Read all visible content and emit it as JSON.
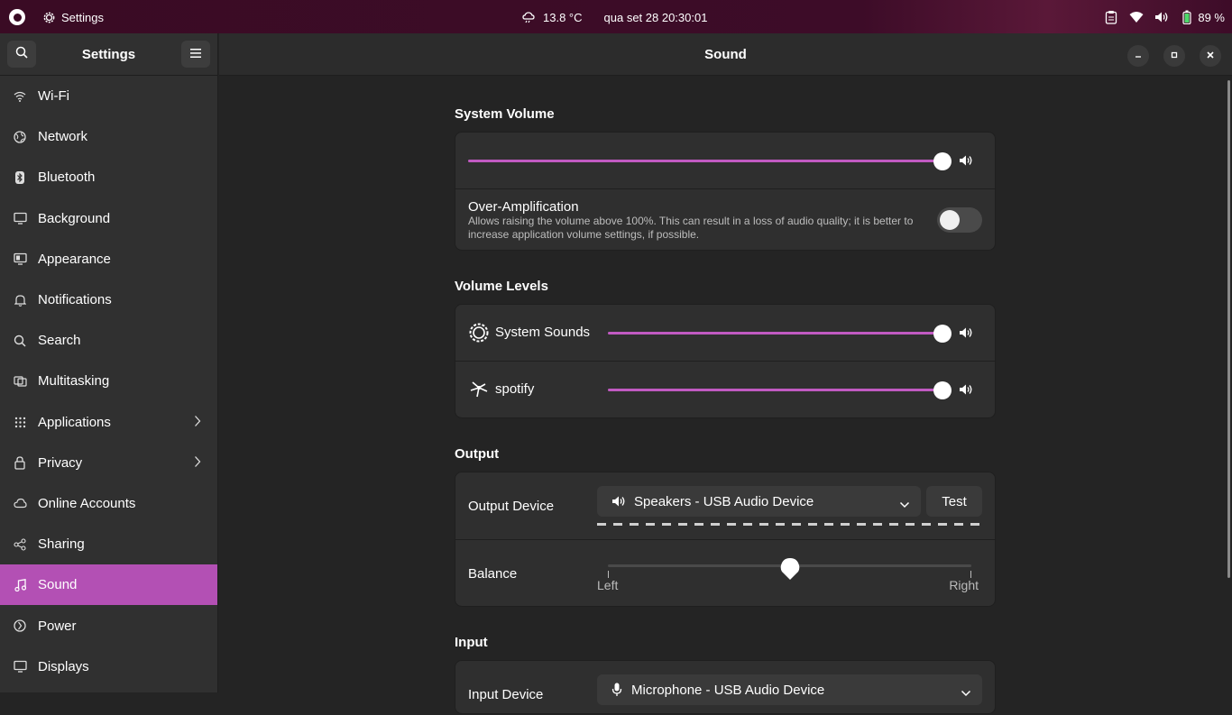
{
  "topbar": {
    "app_name": "Settings",
    "weather": "13.8 °C",
    "datetime": "qua set 28  20:30:01",
    "battery": "89 %"
  },
  "sidebar": {
    "title": "Settings",
    "items": [
      {
        "label": "Wi-Fi",
        "icon": "wifi-icon"
      },
      {
        "label": "Network",
        "icon": "globe-icon"
      },
      {
        "label": "Bluetooth",
        "icon": "bluetooth-icon"
      },
      {
        "label": "Background",
        "icon": "monitor-icon"
      },
      {
        "label": "Appearance",
        "icon": "palette-icon"
      },
      {
        "label": "Notifications",
        "icon": "bell-icon"
      },
      {
        "label": "Search",
        "icon": "search-icon"
      },
      {
        "label": "Multitasking",
        "icon": "windows-icon"
      },
      {
        "label": "Applications",
        "icon": "grid-icon"
      },
      {
        "label": "Privacy",
        "icon": "lock-icon"
      },
      {
        "label": "Online Accounts",
        "icon": "cloud-icon"
      },
      {
        "label": "Sharing",
        "icon": "share-icon"
      },
      {
        "label": "Sound",
        "icon": "music-note-icon"
      },
      {
        "label": "Power",
        "icon": "power-icon"
      },
      {
        "label": "Displays",
        "icon": "display-icon"
      }
    ],
    "active": "Sound"
  },
  "main": {
    "title": "Sound",
    "system_volume": {
      "title": "System Volume",
      "level": 1.0,
      "over_amp_label": "Over-Amplification",
      "over_amp_desc_1": "Allows raising the volume above 100%. This can result in a loss of audio quality; it is better to",
      "over_amp_desc_2": "increase application volume settings, if possible.",
      "over_amp_enabled": false
    },
    "volume_levels": {
      "title": "Volume Levels",
      "items": [
        {
          "label": "System Sounds",
          "level": 1.0
        },
        {
          "label": "spotify",
          "level": 1.0
        }
      ]
    },
    "output": {
      "title": "Output",
      "device_label": "Output Device",
      "device_value": "Speakers - USB Audio Device",
      "test_label": "Test",
      "balance_label": "Balance",
      "balance_level": 0.5,
      "left_label": "Left",
      "right_label": "Right"
    },
    "input": {
      "title": "Input",
      "device_label": "Input Device",
      "device_value": "Microphone - USB Audio Device"
    }
  },
  "colors": {
    "accent": "#c15ac2",
    "active_nav": "#b350b4"
  }
}
